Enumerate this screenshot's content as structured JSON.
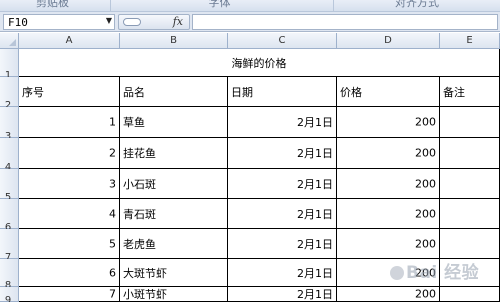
{
  "ribbon": {
    "groups": [
      "剪贴板",
      "字体",
      "对齐方式"
    ]
  },
  "formula_bar": {
    "name_box": "F10",
    "fx_label": "fx",
    "formula": ""
  },
  "columns": [
    "A",
    "B",
    "C",
    "D",
    "E"
  ],
  "rows": [
    "1",
    "2",
    "3",
    "4",
    "5",
    "6",
    "7",
    "8",
    "9"
  ],
  "sheet": {
    "title": "海鲜的价格",
    "headers": [
      "序号",
      "品名",
      "日期",
      "价格",
      "备注"
    ],
    "records": [
      [
        "1",
        "草鱼",
        "2月1日",
        "200",
        ""
      ],
      [
        "2",
        "挂花鱼",
        "2月1日",
        "200",
        ""
      ],
      [
        "3",
        "小石斑",
        "2月1日",
        "200",
        ""
      ],
      [
        "4",
        "青石斑",
        "2月1日",
        "200",
        ""
      ],
      [
        "5",
        "老虎鱼",
        "2月1日",
        "200",
        ""
      ],
      [
        "6",
        "大斑节虾",
        "2月1日",
        "200",
        ""
      ],
      [
        "7",
        "小斑节虾",
        "2月1日",
        "200",
        ""
      ]
    ]
  },
  "watermark": "Bai 经验"
}
